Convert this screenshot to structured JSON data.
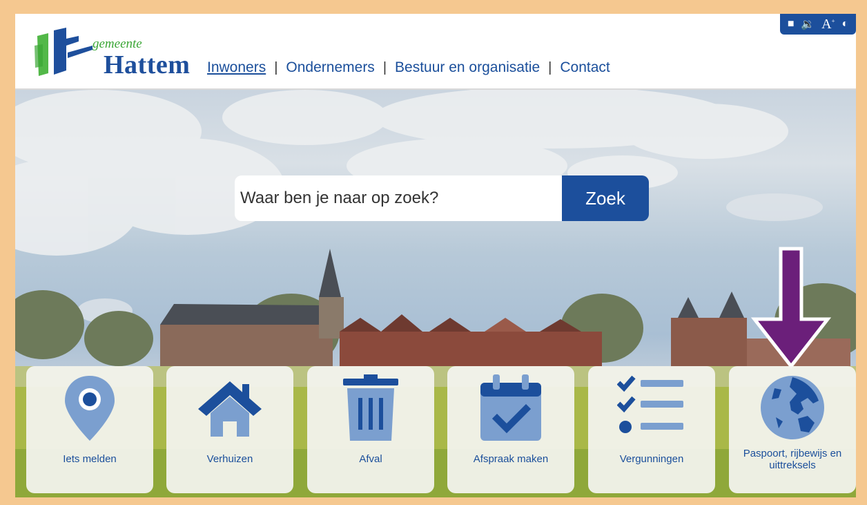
{
  "brand": {
    "small": "gemeente",
    "big": "Hattem"
  },
  "nav": {
    "items": [
      {
        "label": "Inwoners",
        "active": true
      },
      {
        "label": "Ondernemers",
        "active": false
      },
      {
        "label": "Bestuur en organisatie",
        "active": false
      },
      {
        "label": "Contact",
        "active": false
      }
    ],
    "separator": "|"
  },
  "a11y": {
    "text_size_label": "A",
    "icons": [
      "menu-icon",
      "speaker-icon",
      "text-size-icon",
      "contrast-icon"
    ]
  },
  "search": {
    "placeholder": "Waar ben je naar op zoek?",
    "button_label": "Zoek"
  },
  "tiles": [
    {
      "label": "Iets melden",
      "icon": "location-pin-icon"
    },
    {
      "label": "Verhuizen",
      "icon": "house-icon"
    },
    {
      "label": "Afval",
      "icon": "trash-bin-icon"
    },
    {
      "label": "Afspraak maken",
      "icon": "calendar-check-icon"
    },
    {
      "label": "Vergunningen",
      "icon": "checklist-icon"
    },
    {
      "label": "Paspoort, rijbewijs en uittreksels",
      "icon": "globe-icon"
    }
  ],
  "colors": {
    "brand_blue": "#1c4f9c",
    "icon_blue": "#7b9fcf",
    "arrow_purple": "#6b1f7a",
    "frame": "#f5c890"
  }
}
